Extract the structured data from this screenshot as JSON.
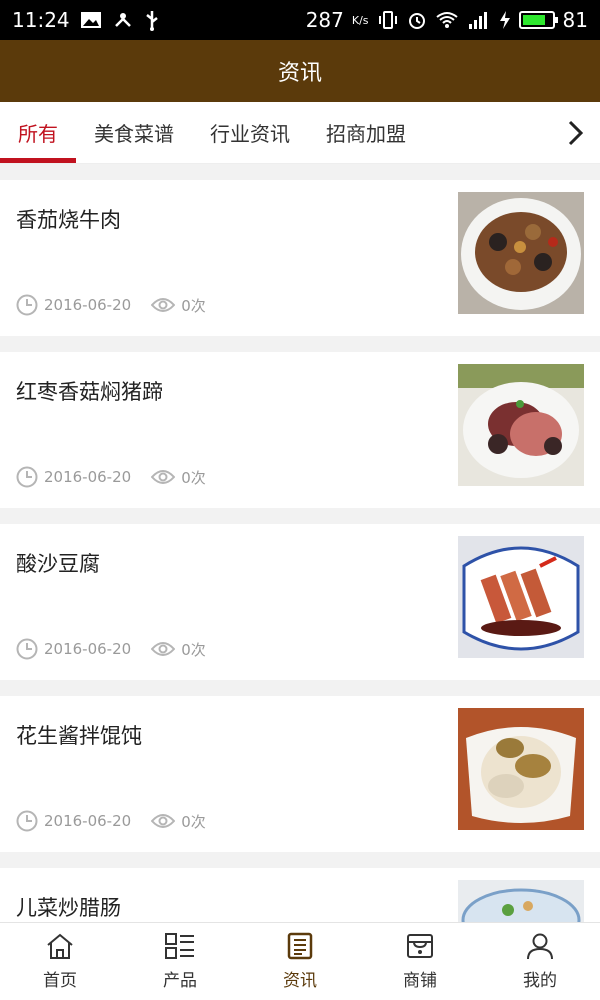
{
  "statusbar": {
    "time": "11:24",
    "speed": "287",
    "speed_unit": "K/s",
    "battery": "81"
  },
  "header": {
    "title": "资讯"
  },
  "tabs": [
    {
      "label": "所有",
      "active": true
    },
    {
      "label": "美食菜谱",
      "active": false
    },
    {
      "label": "行业资讯",
      "active": false
    },
    {
      "label": "招商加盟",
      "active": false
    }
  ],
  "articles": [
    {
      "title": "香茄烧牛肉",
      "date": "2016-06-20",
      "views": "0次"
    },
    {
      "title": "红枣香菇焖猪蹄",
      "date": "2016-06-20",
      "views": "0次"
    },
    {
      "title": "酸沙豆腐",
      "date": "2016-06-20",
      "views": "0次"
    },
    {
      "title": "花生酱拌馄饨",
      "date": "2016-06-20",
      "views": "0次"
    },
    {
      "title": "儿菜炒腊肠",
      "date": "",
      "views": ""
    }
  ],
  "nav": [
    {
      "label": "首页",
      "icon": "home-icon"
    },
    {
      "label": "产品",
      "icon": "list-icon"
    },
    {
      "label": "资讯",
      "icon": "news-icon",
      "active": true
    },
    {
      "label": "商铺",
      "icon": "shop-icon"
    },
    {
      "label": "我的",
      "icon": "user-icon"
    }
  ],
  "colors": {
    "header": "#5b3a0b",
    "accent": "#c1121f"
  }
}
